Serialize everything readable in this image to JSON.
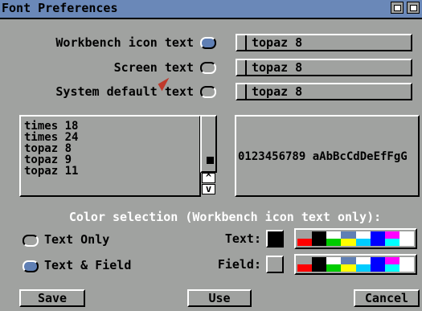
{
  "window": {
    "title": "Font Preferences"
  },
  "font_rows": [
    {
      "label": "Workbench icon text",
      "selected": true,
      "value": "topaz 8"
    },
    {
      "label": "Screen text",
      "selected": false,
      "value": "topaz 8"
    },
    {
      "label": "System default text",
      "selected": false,
      "value": "topaz 8"
    }
  ],
  "font_list": [
    "times 18",
    "times 24",
    "topaz 8",
    "topaz 9",
    "topaz 11"
  ],
  "sample_text": "0123456789 aAbBcCdDeEfFgG",
  "color_selection": {
    "heading": "Color selection (Workbench icon text only):",
    "mode_options": [
      {
        "label": "Text Only",
        "selected": false
      },
      {
        "label": "Text & Field",
        "selected": true
      }
    ],
    "text_label": "Text:",
    "field_label": "Field:",
    "text_color": "#000000",
    "field_color": "#a0a2a0",
    "palette_top": [
      "#a0a2a0",
      "#000000",
      "#ffffff",
      "#5f7fb4",
      "#ffffff",
      "#0000ff",
      "#ff00ff",
      "#ffffff"
    ],
    "palette_bottom": [
      "#ff0000",
      "#000000",
      "#00cc00",
      "#ffff00",
      "#00ccff",
      "#0000ff",
      "#00ffff",
      "#ffffff"
    ]
  },
  "buttons": {
    "save": "Save",
    "use": "Use",
    "cancel": "Cancel"
  }
}
